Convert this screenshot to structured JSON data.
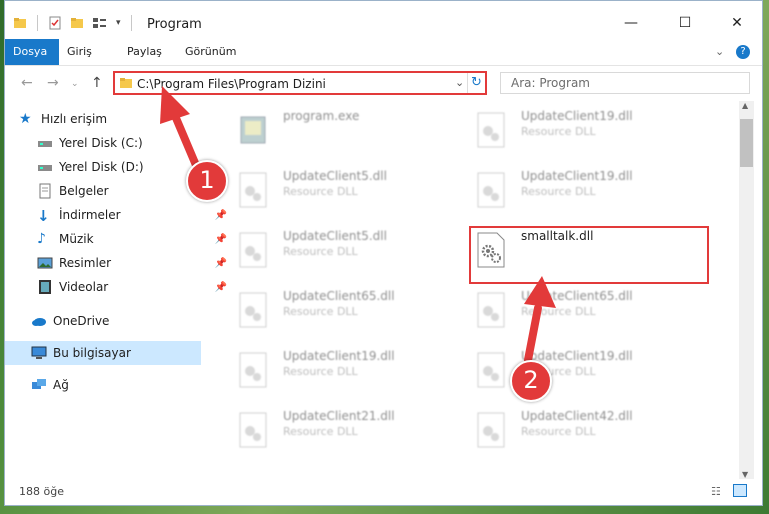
{
  "window": {
    "title": "Program"
  },
  "ribbon": {
    "tabs": [
      "Dosya",
      "Giriş",
      "Paylaş",
      "Görünüm"
    ]
  },
  "address": {
    "path": "C:\\Program Files\\Program Dizini"
  },
  "search": {
    "placeholder": "Ara: Program"
  },
  "sidebar": {
    "items": [
      {
        "label": "Hızlı erişim",
        "icon": "star-icon"
      },
      {
        "label": "Yerel Disk (C:)",
        "icon": "drive-icon"
      },
      {
        "label": "Yerel Disk (D:)",
        "icon": "drive-icon"
      },
      {
        "label": "Belgeler",
        "icon": "documents-icon"
      },
      {
        "label": "İndirmeler",
        "icon": "download-icon"
      },
      {
        "label": "Müzik",
        "icon": "music-icon"
      },
      {
        "label": "Resimler",
        "icon": "pictures-icon"
      },
      {
        "label": "Videolar",
        "icon": "video-icon"
      },
      {
        "label": "OneDrive",
        "icon": "cloud-icon"
      },
      {
        "label": "Bu bilgisayar",
        "icon": "computer-icon"
      },
      {
        "label": "Ağ",
        "icon": "network-icon"
      }
    ]
  },
  "files": [
    {
      "name": "program.exe",
      "type": ""
    },
    {
      "name": "UpdateClient19.dll",
      "type": "Resource DLL"
    },
    {
      "name": "UpdateClient5.dll",
      "type": "Resource DLL"
    },
    {
      "name": "UpdateClient19.dll",
      "type": "Resource DLL"
    },
    {
      "name": "UpdateClient5.dll",
      "type": "Resource DLL"
    },
    {
      "name": "smalltalk.dll",
      "type": ""
    },
    {
      "name": "UpdateClient65.dll",
      "type": "Resource DLL"
    },
    {
      "name": "UpdateClient65.dll",
      "type": "Resource DLL"
    },
    {
      "name": "UpdateClient19.dll",
      "type": "Resource DLL"
    },
    {
      "name": "UpdateClient19.dll",
      "type": "Resource DLL"
    },
    {
      "name": "UpdateClient21.dll",
      "type": "Resource DLL"
    },
    {
      "name": "UpdateClient42.dll",
      "type": "Resource DLL"
    }
  ],
  "status": {
    "count": "188 öğe"
  },
  "annotations": {
    "badge1": "1",
    "badge2": "2"
  },
  "colors": {
    "accent": "#1979ca",
    "highlight": "#e23a3a",
    "selected": "#cce8ff"
  }
}
